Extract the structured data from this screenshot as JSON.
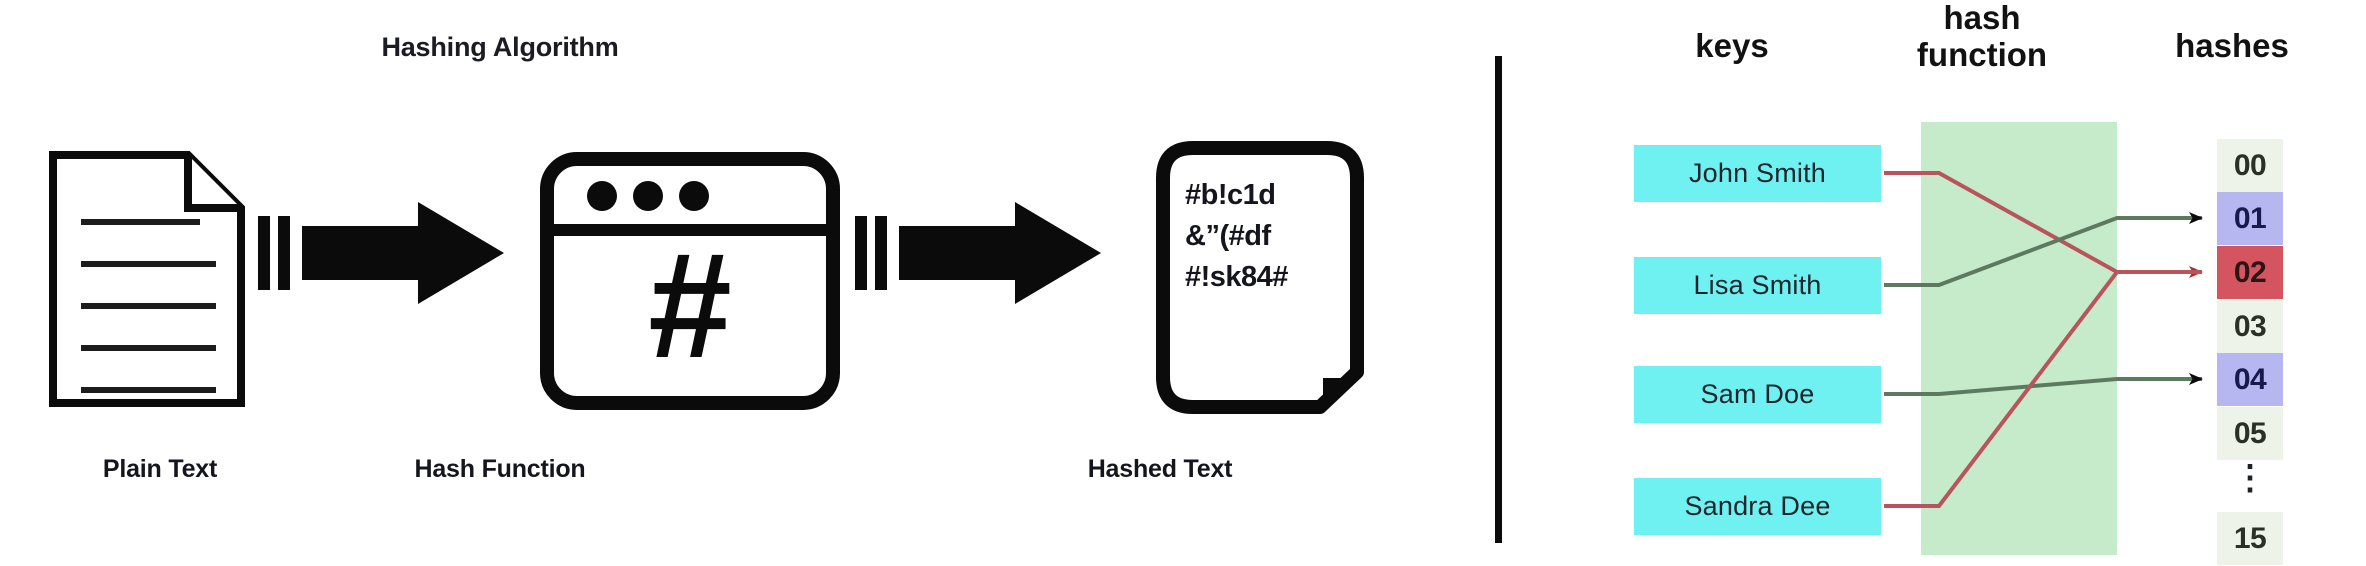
{
  "left": {
    "title": "Hashing Algorithm",
    "stages": [
      {
        "caption": "Plain Text",
        "icon": "document-icon"
      },
      {
        "caption": "Hash Function",
        "icon": "hash-window-icon"
      },
      {
        "caption": "Hashed Text",
        "icon": "hashed-document-icon"
      }
    ],
    "hashed_text_lines": [
      "#b!c1d",
      "&”(#df",
      "#!sk84#"
    ],
    "hash_glyph": "#",
    "arrow_label": "flow-arrow"
  },
  "right": {
    "headers": {
      "keys": "keys",
      "function_line1": "hash",
      "function_line2": "function",
      "hashes": "hashes"
    },
    "keys": [
      {
        "label": "John Smith"
      },
      {
        "label": "Lisa Smith"
      },
      {
        "label": "Sam Doe"
      },
      {
        "label": "Sandra Dee"
      }
    ],
    "slots": [
      {
        "label": "00",
        "state": "empty"
      },
      {
        "label": "01",
        "state": "filled"
      },
      {
        "label": "02",
        "state": "collision"
      },
      {
        "label": "03",
        "state": "empty"
      },
      {
        "label": "04",
        "state": "filled"
      },
      {
        "label": "05",
        "state": "empty"
      },
      {
        "label": "⋮",
        "state": "ellipsis"
      },
      {
        "label": "15",
        "state": "empty"
      }
    ],
    "mappings": [
      {
        "key": "John Smith",
        "slot": "02",
        "color": "#b9545c"
      },
      {
        "key": "Lisa Smith",
        "slot": "01",
        "color": "#4e6b52"
      },
      {
        "key": "Sam Doe",
        "slot": "04",
        "color": "#4e6b52"
      },
      {
        "key": "Sandra Dee",
        "slot": "02",
        "color": "#b9545c"
      }
    ]
  },
  "colors": {
    "key_box": "#6ff1f1",
    "hash_band": "#c5ebcb",
    "slot_empty": "#eef3ea",
    "slot_filled": "#b6b6f0",
    "slot_collision": "#d4555f",
    "ink": "#0b0b0b",
    "arrow_collision": "#b9545c",
    "arrow_normal": "#4a4a4a"
  }
}
